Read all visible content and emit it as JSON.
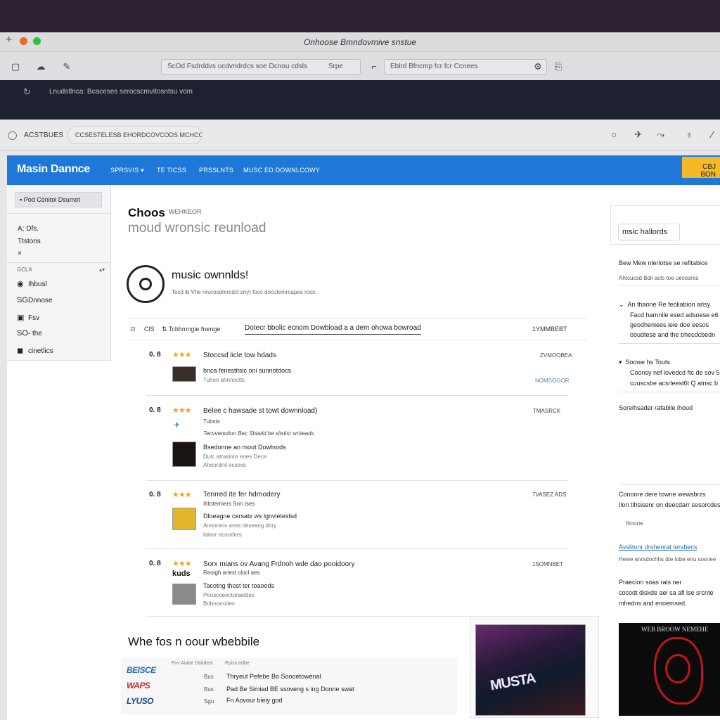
{
  "window": {
    "title": "Onhoose Bmndovmive snstue",
    "plus_glyph": "+",
    "traffic_colors": [
      "#2c2130",
      "#f0652b",
      "#2cc13e"
    ]
  },
  "toolbar": {
    "icons": [
      "square-icon",
      "cloud-icon",
      "pen-icon",
      "download-icon",
      "gear-icon",
      "copy-icon"
    ],
    "address_left": "ScOd Fsdrddvs ucdvndrdcs soe Dcnou cdsls",
    "address_left_suffix": "Srpe",
    "address_right": "Eblrd Bfncmp fcr fcr Ccnees"
  },
  "notice": {
    "text": "Lnudstlnca: Bcaceses serocscmvitosntsu vom"
  },
  "tabbar": {
    "label": "ACSTBUES",
    "tab_title": "CCSESTELESB EHORDCOVCODS MCHCOEE"
  },
  "site": {
    "logo": "Masin Dannce",
    "nav": [
      {
        "label": "SPRSVIS ▾"
      },
      {
        "label": "TE TICSS"
      },
      {
        "label": "PRSSLNTS"
      },
      {
        "label": "MUSC ED DOWNLCOWY"
      }
    ],
    "badge": "CBJ BON"
  },
  "sidebar": {
    "header": "Pod Conitol Dsumot",
    "plain_items": [
      "A; Dfs.",
      "Ttstons",
      "×"
    ],
    "section_label": "GCLA",
    "section_control": "▴▾",
    "items": [
      {
        "icon": "◉",
        "label": "Ihbusl"
      },
      {
        "icon": "SG",
        "label": "Dnnose"
      },
      {
        "icon": "▣",
        "label": "Fsv"
      },
      {
        "icon": "SO-",
        "label": "the"
      },
      {
        "icon": "◼",
        "label": "cinetlics"
      }
    ]
  },
  "main": {
    "heading_a": "Choos",
    "heading_a_small": "WEHKEOR",
    "heading_b": "moud wronsic reunload",
    "feature_title": "music ownnlds!",
    "feature_sub": "Tecd ib Vhe revcosdmrcdcl sny) focc docutemrcapes rocs.",
    "table_header": {
      "col1": "ClS",
      "col2": "Tcbhmngie fnenge",
      "link": "Dotecr bbolic ecnom Dowbload a a dem ohowa bowroad",
      "col4": "1YMMBEBT"
    },
    "rows": [
      {
        "score": "0. 8",
        "stars": "★★★",
        "title": "Stoccsd licle tow hdads",
        "right_meta": "ZVMOOBEA",
        "sub": "bnca fenestitsic oni sunnotdocs",
        "sub2": "Tuhoo ahnnoctls",
        "right_link": "NOMSOGOR"
      },
      {
        "score": "0. 8",
        "stars": "★★★",
        "title": "Belee c hawsade st towt downnload)",
        "right_meta": "TMASRCK",
        "sub": "Bsedonne an mout Dowlnods",
        "sub2": "Dutc atrasinre eoes Dece",
        "extra_meta_a": "Tubsts",
        "extra_meta_b": "Tecvvenotion Bec Sbiatid be siistist srriteads",
        "sub3": "Aheordnil ecsexs"
      },
      {
        "score": "0. 8",
        "stars": "★★★",
        "title": "Tenrred ite fer hdrnodery",
        "right_meta": "7VASEZ ADS",
        "meta_under": "Ihtoterniers Snn Ises",
        "sub": "Dloeagne cersatx ws lgnvleteslsd",
        "sub2": "Anooreos aves deseang dory",
        "sub3": "laieor ecooders"
      },
      {
        "score": "0. 8",
        "stars": "★★★",
        "title": "Sorx mians ov Avang Frdnoh wde dao pooidoory",
        "right_meta": "1SOMNBET",
        "thumb_label": "kuds",
        "meta_under": "Reoigh ariest clocl aes",
        "sub": "Tacotng thost ter toaoods",
        "sub2": "Peoscoeectoraetdes",
        "sub3": "Bobnoeodes"
      }
    ],
    "heading_2": "Whe fos n oour wbebbile",
    "mini_header": [
      "Fnv Aiabe Dtiddest",
      "Ppiss edbe"
    ],
    "mini_rows": [
      {
        "logo": "BEISCE",
        "side": "Bus",
        "text": "Thryeut Pefebe Bo Soooetowenal"
      },
      {
        "logo": "WAPS",
        "side": "Bus",
        "text": "Pad Be Simiad BE ssoveng s ing Donne swat"
      },
      {
        "logo": "LYUSO",
        "side": "Sgu",
        "text": "Fn Aovour bieiy god"
      }
    ],
    "poster_text": "MUSTA"
  },
  "right_panel": {
    "chip": "msic hallords",
    "line1": "Bew Mew nlerlotse se refitabice",
    "line1_sub": "Ahtcucsd Bdil actc toe uecesres",
    "section1_title": "An thaone Re feoliabion arisy",
    "section1_lines": [
      "Facd harnnile esed adsoese e6",
      "geodheniees ieie doe eesos",
      "ooudtese and the bhecdcbedn"
    ],
    "section2_title": "Soowe hs Touts",
    "section2_lines": [
      "Coonsy nef lovedcd ftc de sov 5",
      "cuuscsbe acsrleest6t Q atnsc b"
    ],
    "section3": "Soreihsader rafabile ihoud",
    "section4": [
      "Conoore dere towne wewsbrzs",
      "Ilon tlhsisenr on deecdarr sesorcdesve"
    ],
    "small_chip": "Ihnorie",
    "link": "Avslitonr drsheorat tersbecs",
    "link_sub": "Hewe anrsdochhs dte lobe enu sosnee",
    "section5": [
      "Praecion soas rais ner",
      "cocodt diskde ael sa afl lse srcnte",
      "mhedns and enoemsed."
    ],
    "art_title": "WEB BROOW NEMEHE"
  }
}
